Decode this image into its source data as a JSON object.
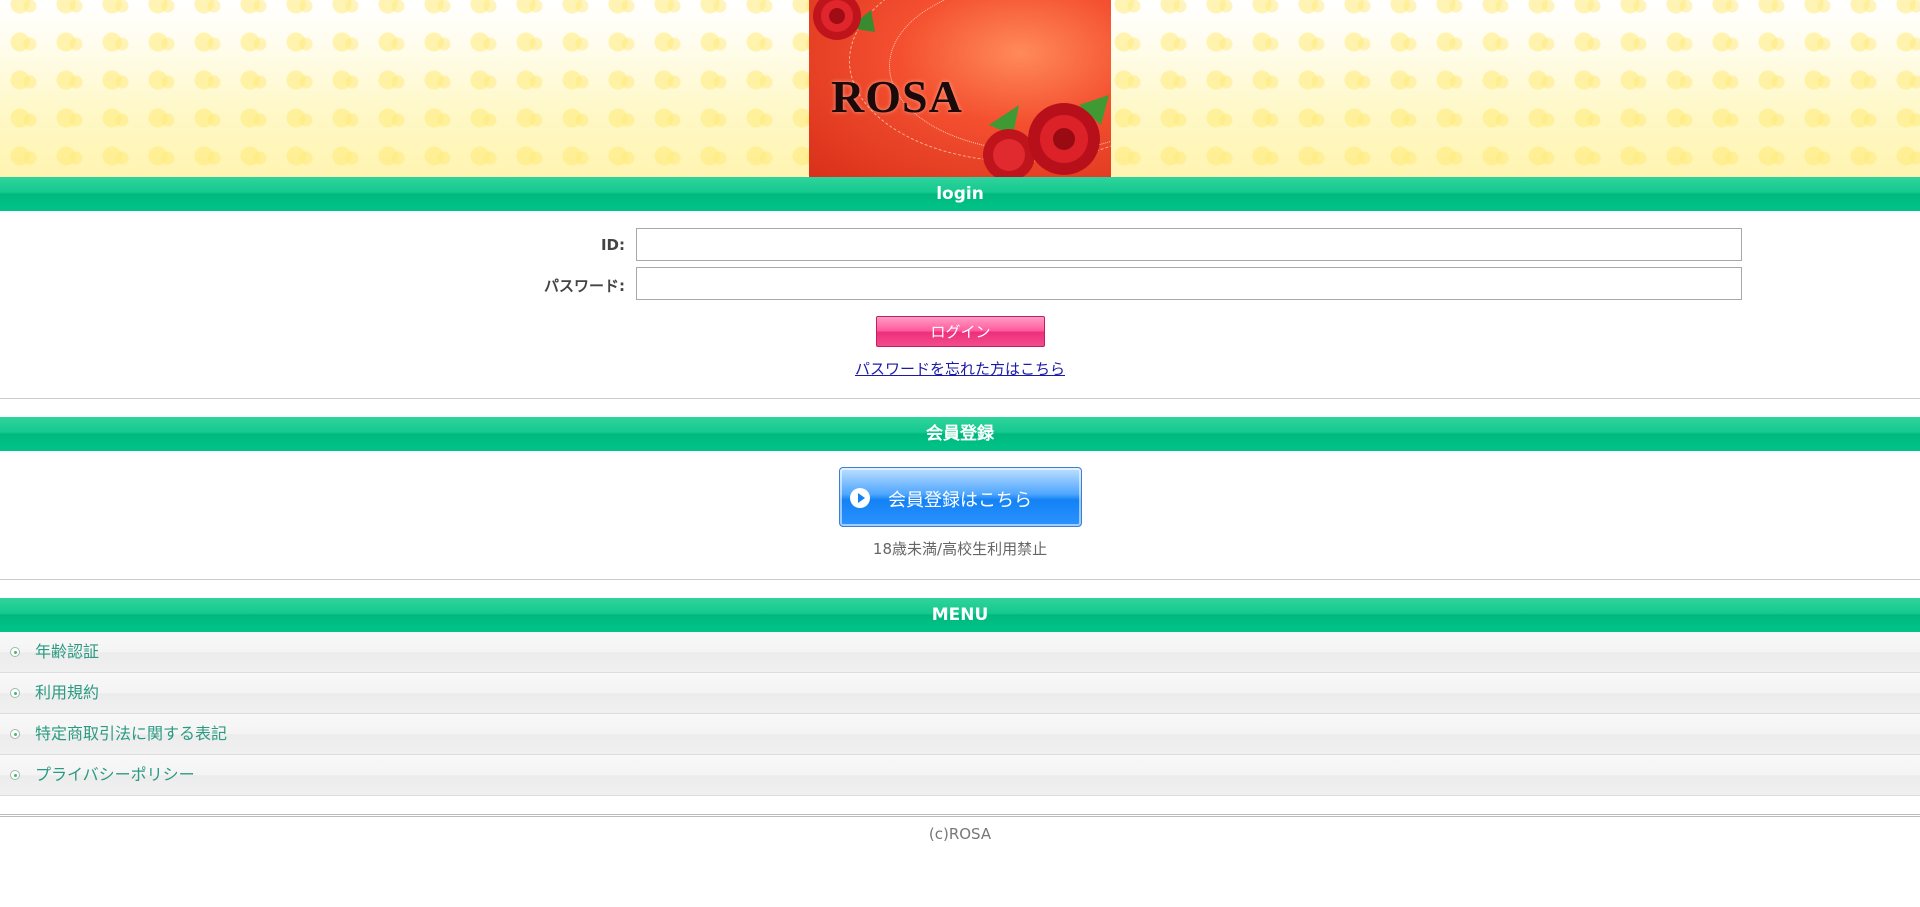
{
  "banner": {
    "title": "ROSA"
  },
  "login": {
    "heading": "login",
    "id_label": "ID:",
    "id_value": "",
    "password_label": "パスワード:",
    "password_value": "",
    "submit_label": "ログイン",
    "forgot_link": "パスワードを忘れた方はこちら"
  },
  "register": {
    "heading": "会員登録",
    "button_label": "会員登録はこちら",
    "notice": "18歳未満/高校生利用禁止"
  },
  "menu": {
    "heading": "MENU",
    "items": [
      {
        "label": "年齢認証"
      },
      {
        "label": "利用規約"
      },
      {
        "label": "特定商取引法に関する表記"
      },
      {
        "label": "プライバシーポリシー"
      }
    ]
  },
  "footer": {
    "copyright": "(c)ROSA"
  },
  "colors": {
    "section_bar": "#00c489",
    "login_button": "#ee2e7c",
    "register_button": "#1382f5",
    "menu_text": "#2a9a82",
    "link": "#1a1aa8"
  }
}
